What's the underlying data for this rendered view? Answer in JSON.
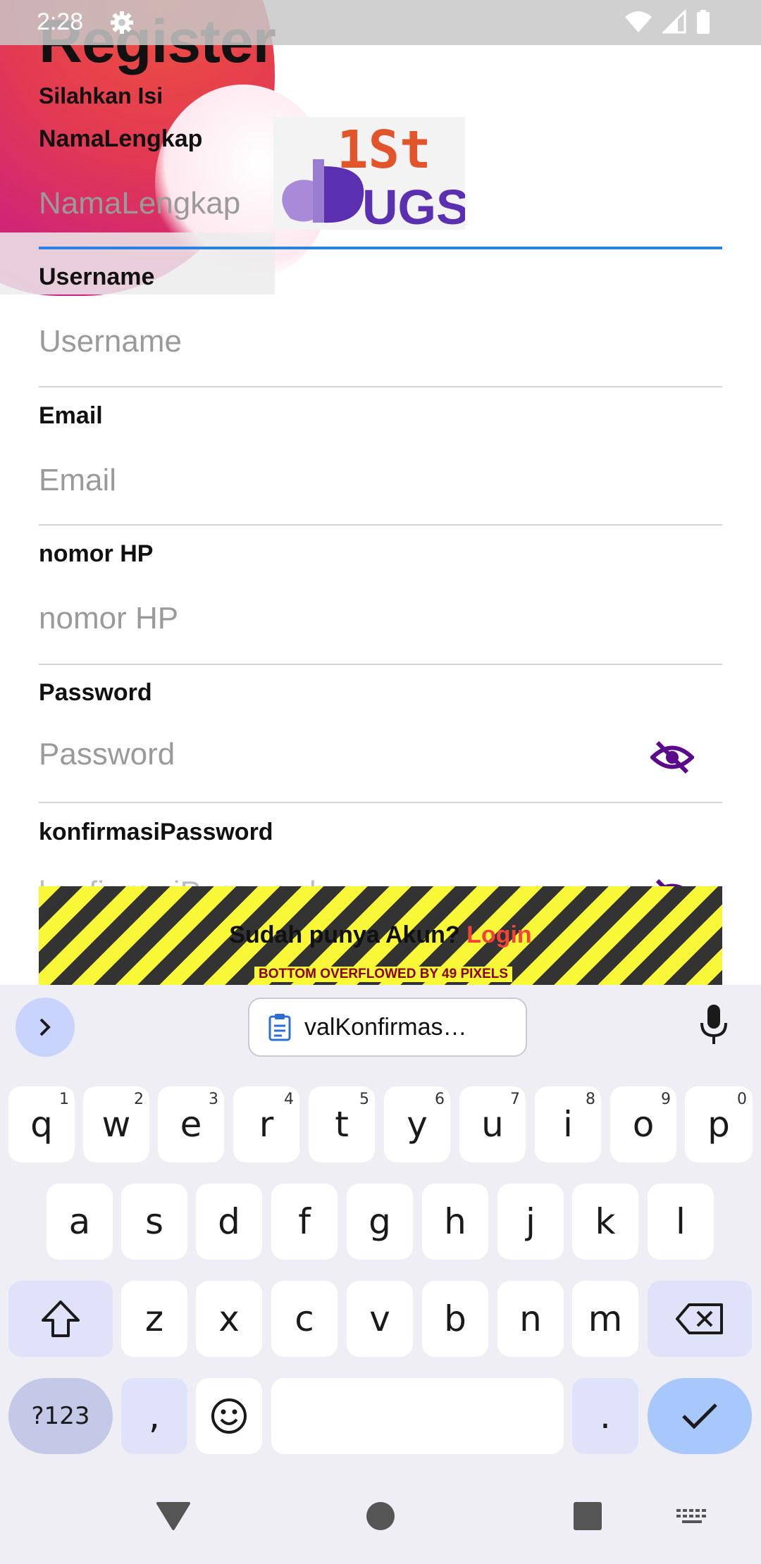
{
  "status_bar": {
    "time": "2:28"
  },
  "page": {
    "title": "Register",
    "subtitle": "Silahkan Isi"
  },
  "logo": {
    "text_top": "1St",
    "text_bottom": "UGS"
  },
  "form": {
    "fields": [
      {
        "label": "NamaLengkap",
        "placeholder": "NamaLengkap"
      },
      {
        "label": "Username",
        "placeholder": "Username"
      },
      {
        "label": "Email",
        "placeholder": "Email"
      },
      {
        "label": "nomor HP",
        "placeholder": "nomor HP"
      },
      {
        "label": "Password",
        "placeholder": "Password"
      },
      {
        "label": "konfirmasiPassword",
        "placeholder": "konfirmasiPassword"
      }
    ],
    "login_prompt": "Sudah punya Akun?",
    "login_link": "Login",
    "overflow_warning": "BOTTOM OVERFLOWED BY 49 PIXELS"
  },
  "keyboard": {
    "clipboard_chip": "valKonfirmas…",
    "row1": [
      {
        "key": "q",
        "hint": "1"
      },
      {
        "key": "w",
        "hint": "2"
      },
      {
        "key": "e",
        "hint": "3"
      },
      {
        "key": "r",
        "hint": "4"
      },
      {
        "key": "t",
        "hint": "5"
      },
      {
        "key": "y",
        "hint": "6"
      },
      {
        "key": "u",
        "hint": "7"
      },
      {
        "key": "i",
        "hint": "8"
      },
      {
        "key": "o",
        "hint": "9"
      },
      {
        "key": "p",
        "hint": "0"
      }
    ],
    "row2": [
      "a",
      "s",
      "d",
      "f",
      "g",
      "h",
      "j",
      "k",
      "l"
    ],
    "row3": [
      "z",
      "x",
      "c",
      "v",
      "b",
      "n",
      "m"
    ],
    "symbols_key": "?123",
    "comma_key": ",",
    "period_key": "."
  },
  "colors": {
    "accent_underline": "#2b82e3",
    "login_link": "#f44336",
    "eye_icon": "#5a0a8a",
    "overflow_yellow": "#f8f839"
  }
}
